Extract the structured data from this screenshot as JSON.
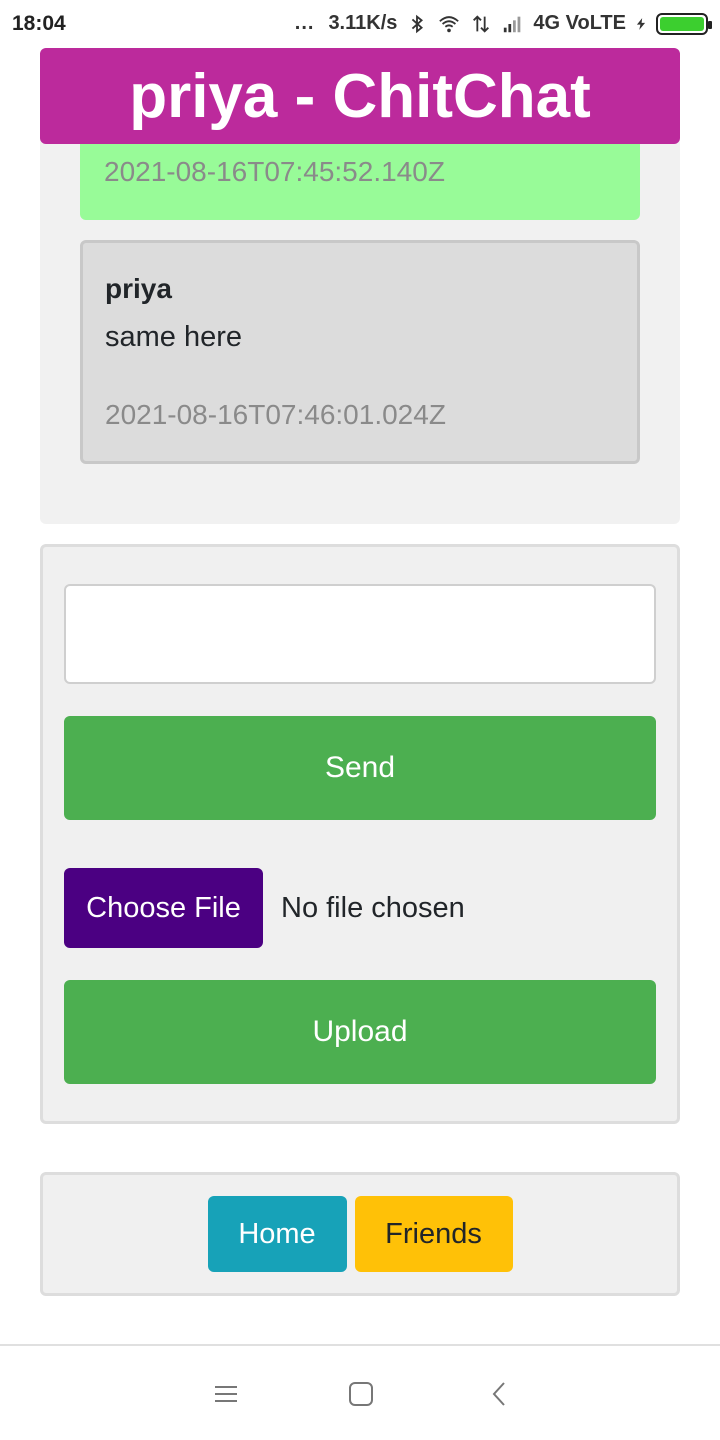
{
  "status_bar": {
    "time": "18:04",
    "dots": "...",
    "speed": "3.11K/s",
    "network": "4G VoLTE",
    "icons": [
      "bluetooth-icon",
      "wifi-icon",
      "data-arrows-icon",
      "signal-icon",
      "charging-icon",
      "battery-icon"
    ],
    "battery_color": "#3ccf2f"
  },
  "header": {
    "title": "priya - ChitChat",
    "color": "#bc2a9c"
  },
  "messages": [
    {
      "timestamp": "2021-08-16T07:45:52.140Z",
      "color": "#98fb98"
    },
    {
      "sender": "priya",
      "text": "same here",
      "timestamp": "2021-08-16T07:46:01.024Z",
      "color": "#dcdcdc"
    }
  ],
  "compose": {
    "input_value": "",
    "send_label": "Send",
    "choose_file_label": "Choose File",
    "file_status": "No file chosen",
    "upload_label": "Upload",
    "accent": "#4caf50",
    "file_button_color": "#4b0082"
  },
  "nav": {
    "home_label": "Home",
    "friends_label": "Friends",
    "home_color": "#17a2b8",
    "friends_color": "#ffc107"
  },
  "system_nav": {
    "icons": [
      "menu-icon",
      "home-square-icon",
      "back-icon"
    ]
  }
}
